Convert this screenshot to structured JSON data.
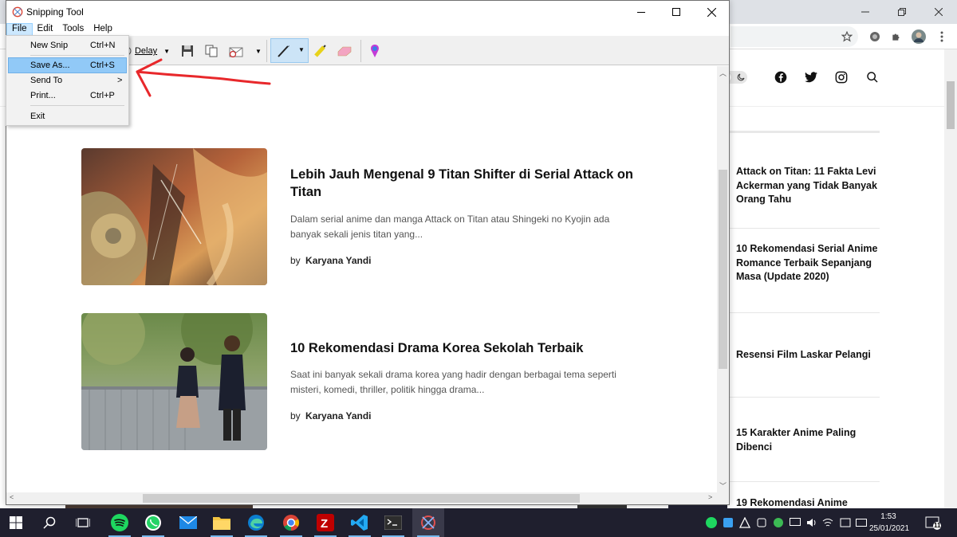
{
  "browser": {
    "window_controls": [
      "—",
      "❐",
      "✕"
    ],
    "social_icons": [
      "facebook-icon",
      "twitter-icon",
      "instagram-icon",
      "search-icon"
    ],
    "sidebar_posts": [
      {
        "title": "Attack on Titan: 11 Fakta Levi Ackerman yang Tidak Banyak Orang Tahu"
      },
      {
        "title": "10 Rekomendasi Serial Anime Romance Terbaik Sepanjang Masa (Update 2020)"
      },
      {
        "title": "Resensi Film Laskar Pelangi"
      },
      {
        "title": "15 Karakter Anime Paling Dibenci"
      },
      {
        "title": "19 Rekomendasi Anime"
      }
    ]
  },
  "snipping_tool": {
    "title": "Snipping Tool",
    "menus": [
      "File",
      "Edit",
      "Tools",
      "Help"
    ],
    "delay_label": "Delay",
    "file_menu": [
      {
        "label": "New Snip",
        "shortcut": "Ctrl+N"
      },
      {
        "label": "Save As...",
        "shortcut": "Ctrl+S"
      },
      {
        "label": "Send To",
        "shortcut": ">"
      },
      {
        "label": "Print...",
        "shortcut": "Ctrl+P"
      },
      {
        "label": "Exit",
        "shortcut": ""
      }
    ],
    "posts": [
      {
        "title": "Lebih Jauh Mengenal 9 Titan Shifter di Serial Attack on Titan",
        "excerpt": "Dalam serial anime dan manga Attack on Titan atau Shingeki no Kyojin ada banyak sekali jenis titan yang...",
        "by": "by",
        "author": "Karyana Yandi"
      },
      {
        "title": "10 Rekomendasi Drama Korea Sekolah Terbaik",
        "excerpt": "Saat ini banyak sekali drama korea yang hadir dengan berbagai tema seperti misteri, komedi, thriller, politik hingga drama...",
        "by": "by",
        "author": "Karyana Yandi"
      }
    ]
  },
  "taskbar": {
    "time": "1:53",
    "date": "25/01/2021",
    "notification_count": "11",
    "apps": [
      "start",
      "search",
      "task-view",
      "spotify",
      "whatsapp",
      "mail",
      "file-explorer",
      "edge",
      "chrome",
      "filezilla",
      "vscode",
      "terminal",
      "snipping-tool"
    ]
  },
  "colors": {
    "annotation": "#e8282b",
    "taskbar": "#1f1f2e",
    "menu_highlight": "#91c9f7"
  }
}
